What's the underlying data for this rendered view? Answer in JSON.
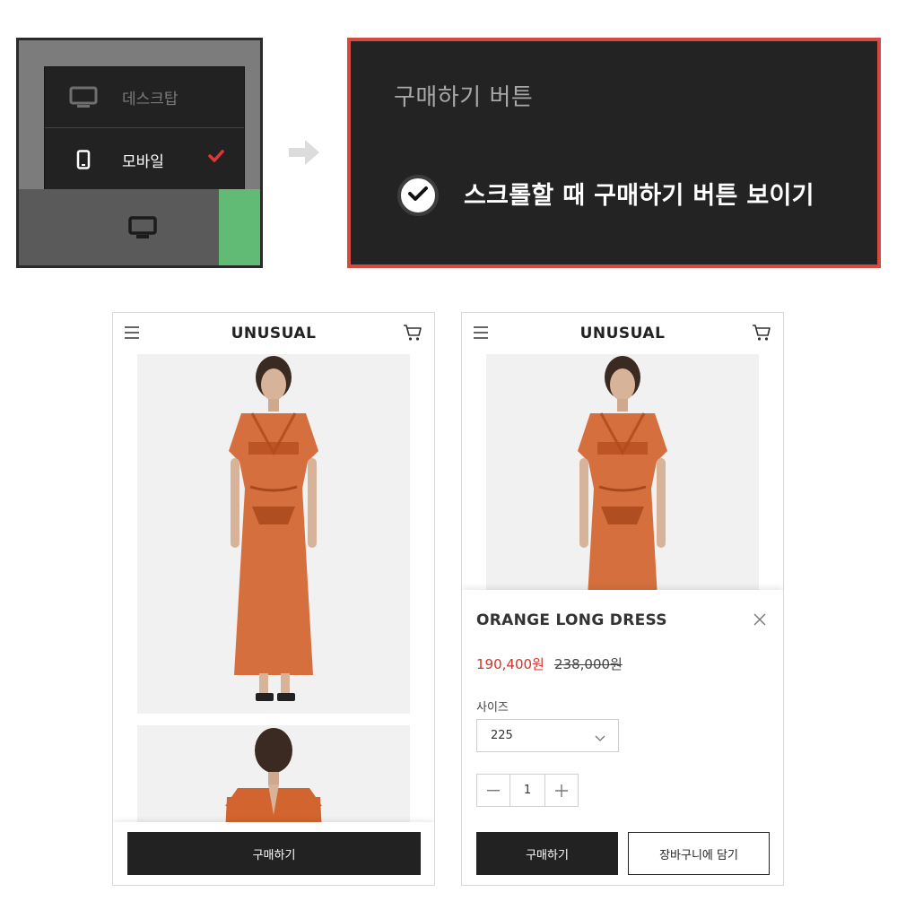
{
  "switcher": {
    "desktop_label": "데스크탑",
    "mobile_label": "모바일",
    "icons": [
      "desktop-icon",
      "mobile-icon",
      "checkmark-icon"
    ],
    "check_color": "#e0373b",
    "accent_green": "#62bb74"
  },
  "setting": {
    "title": "구매하기 버튼",
    "option_label": "스크롤할 때 구매하기 버튼 보이기",
    "checked": true,
    "border_color": "#d24a42"
  },
  "phone1": {
    "logo": "UNUSUAL",
    "buy_button": "구매하기"
  },
  "phone2": {
    "logo": "UNUSUAL",
    "product_name": "ORANGE LONG DRESS",
    "sale_price": "190,400원",
    "original_price": "238,000원",
    "size_label": "사이즈",
    "size_value": "225",
    "quantity": "1",
    "buy_button": "구매하기",
    "cart_button": "장바구니에 담기",
    "price_color": "#d4322b"
  }
}
